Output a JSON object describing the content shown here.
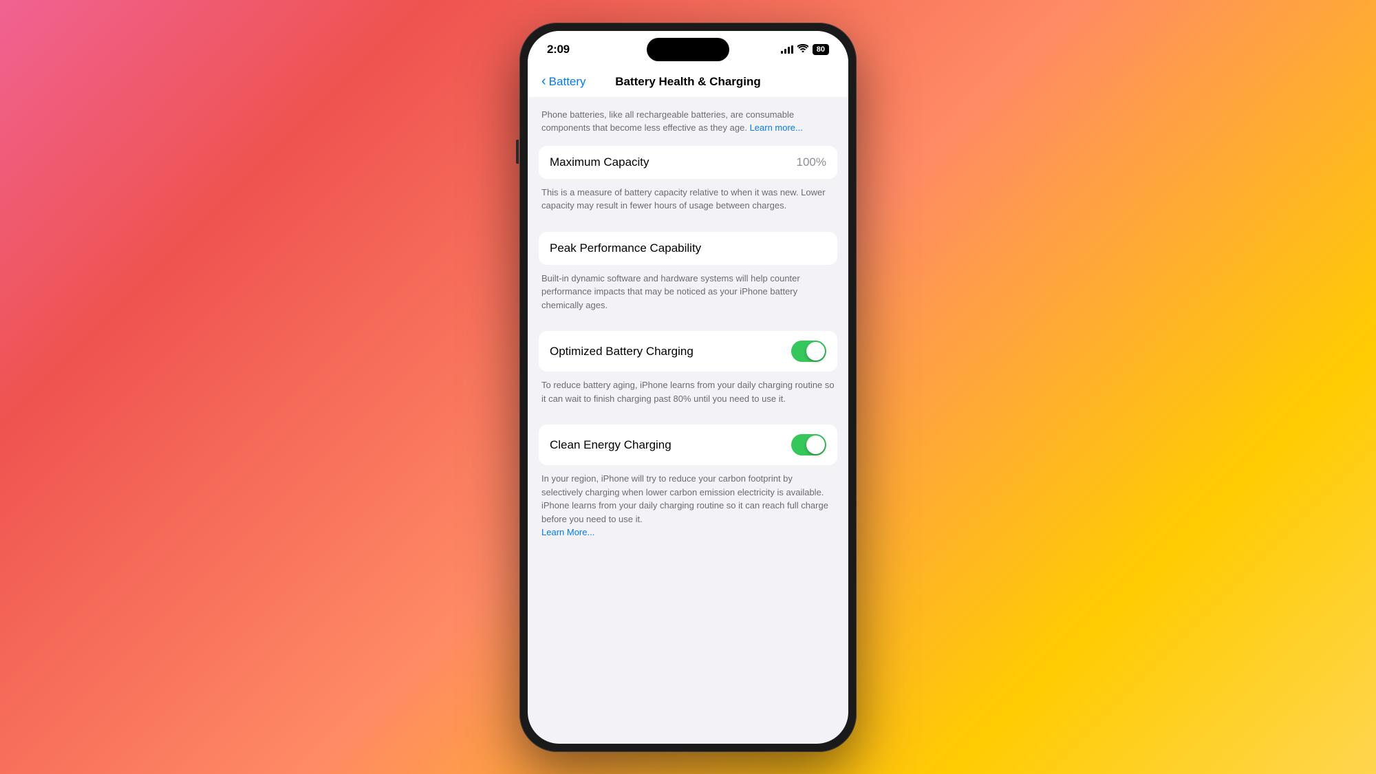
{
  "status_bar": {
    "time": "2:09",
    "battery_level": "80",
    "battery_label": "80"
  },
  "nav": {
    "back_label": "Battery",
    "title": "Battery Health & Charging"
  },
  "description": {
    "text": "Phone batteries, like all rechargeable batteries, are consumable components that become less effective as they age.",
    "learn_more": "Learn more..."
  },
  "max_capacity": {
    "label": "Maximum Capacity",
    "value": "100%",
    "description": "This is a measure of battery capacity relative to when it was new. Lower capacity may result in fewer hours of usage between charges."
  },
  "peak_performance": {
    "label": "Peak Performance Capability",
    "description": "Built-in dynamic software and hardware systems will help counter performance impacts that may be noticed as your iPhone battery chemically ages."
  },
  "optimized_charging": {
    "label": "Optimized Battery Charging",
    "toggle_state": true,
    "description": "To reduce battery aging, iPhone learns from your daily charging routine so it can wait to finish charging past 80% until you need to use it."
  },
  "clean_energy": {
    "label": "Clean Energy Charging",
    "toggle_state": true,
    "description": "In your region, iPhone will try to reduce your carbon footprint by selectively charging when lower carbon emission electricity is available. iPhone learns from your daily charging routine so it can reach full charge before you need to use it.",
    "learn_more": "Learn More..."
  }
}
